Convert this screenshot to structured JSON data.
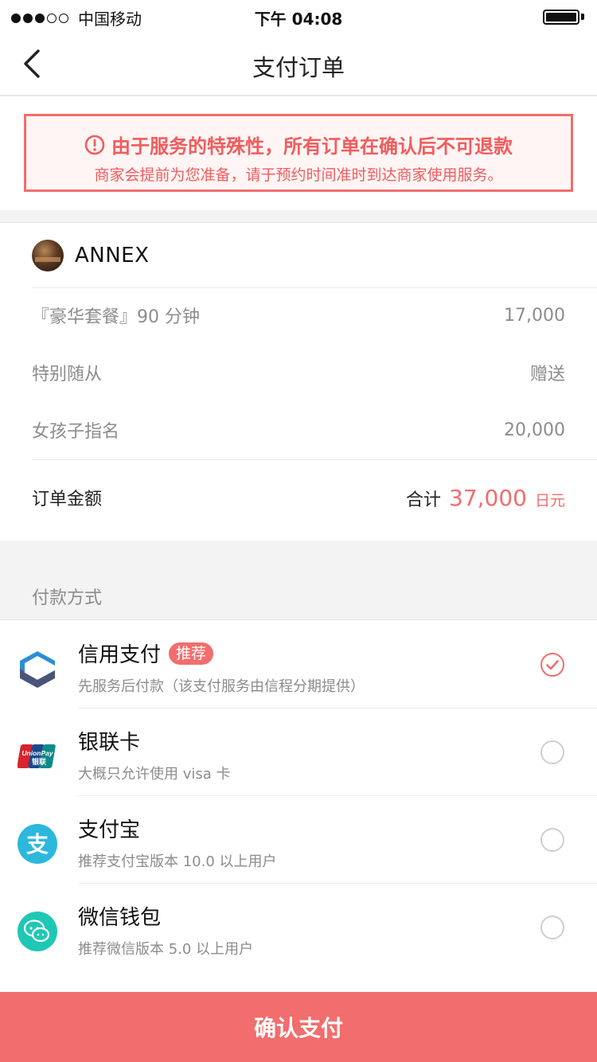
{
  "status_bar": {
    "carrier": "中国移动",
    "time": "下午 04:08",
    "signal_bars_filled": 3,
    "signal_bars_total": 5
  },
  "nav": {
    "title": "支付订单",
    "back_icon": "chevron-left-icon"
  },
  "notice": {
    "icon": "alert-circle-icon",
    "line1": "由于服务的特殊性，所有订单在确认后不可退款",
    "line2": "商家会提前为您准备，请于预约时间准时到达商家使用服务。",
    "color": "#f25c5c"
  },
  "order": {
    "merchant_name": "ANNEX",
    "items": [
      {
        "name": "『豪华套餐』90 分钟",
        "value": "17,000"
      },
      {
        "name": "特别随从",
        "value": "赠送"
      },
      {
        "name": "女孩子指名",
        "value": "20,000"
      }
    ],
    "total_label": "订单金额",
    "total_prefix": "合计",
    "total_amount": "37,000",
    "total_unit": "日元"
  },
  "payment": {
    "section_title": "付款方式",
    "methods": [
      {
        "name": "信用支付",
        "badge": "推荐",
        "desc": "先服务后付款（该支付服务由信程分期提供）",
        "icon": "credit-pay-icon",
        "selected": true
      },
      {
        "name": "银联卡",
        "badge": "",
        "desc": "大概只允许使用 visa 卡",
        "icon": "unionpay-icon",
        "selected": false,
        "logo_text_top": "UnionPay",
        "logo_text_bottom": "银联"
      },
      {
        "name": "支付宝",
        "badge": "",
        "desc": "推荐支付宝版本 10.0 以上用户",
        "icon": "alipay-icon",
        "selected": false,
        "logo_text": "支"
      },
      {
        "name": "微信钱包",
        "badge": "",
        "desc": "推荐微信版本 5.0 以上用户",
        "icon": "wechat-pay-icon",
        "selected": false
      }
    ]
  },
  "confirm_button": "确认支付",
  "colors": {
    "accent": "#f26d6d",
    "alipay": "#2cb8dd",
    "wechat": "#1ec8b4",
    "credit_blue": "#2b8ed8",
    "credit_navy": "#4a5478"
  }
}
